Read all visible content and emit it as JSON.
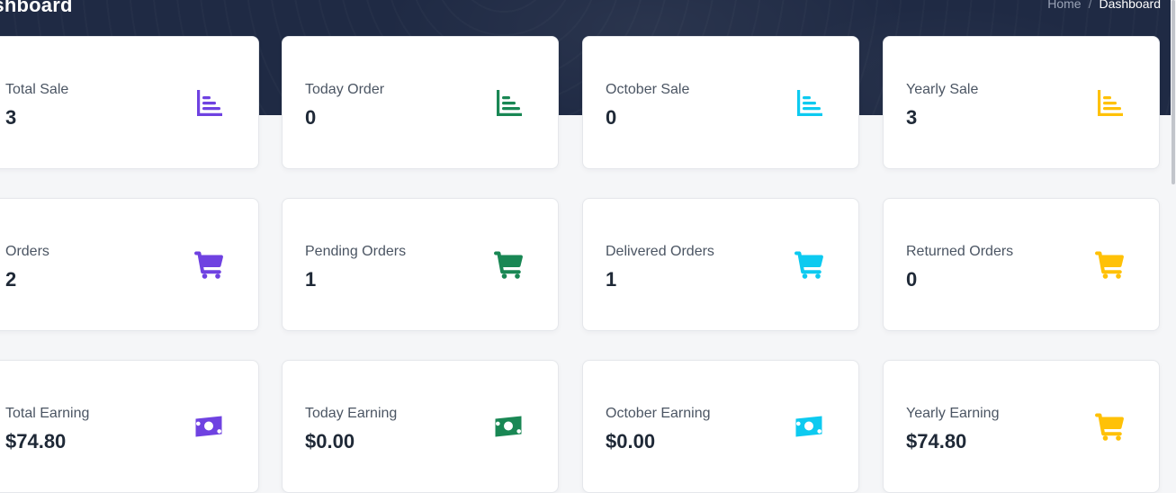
{
  "header": {
    "title": "ashboard",
    "breadcrumb": {
      "home": "Home",
      "separator": "/",
      "current": "Dashboard"
    }
  },
  "colors": {
    "header_bg": "#1f2a44",
    "purple": "#6f42e1",
    "green": "#198754",
    "cyan": "#0dcaf0",
    "yellow": "#ffc107"
  },
  "cards": {
    "total_sale": {
      "label": "Total Sale",
      "value": "3",
      "icon": "bar-chart-icon",
      "color": "#6f42e1"
    },
    "today_order": {
      "label": "Today Order",
      "value": "0",
      "icon": "bar-chart-icon",
      "color": "#198754"
    },
    "october_sale": {
      "label": "October Sale",
      "value": "0",
      "icon": "bar-chart-icon",
      "color": "#0dcaf0"
    },
    "yearly_sale": {
      "label": "Yearly Sale",
      "value": "3",
      "icon": "bar-chart-icon",
      "color": "#ffc107"
    },
    "orders": {
      "label": "Orders",
      "value": "2",
      "icon": "cart-icon",
      "color": "#6f42e1"
    },
    "pending_orders": {
      "label": "Pending Orders",
      "value": "1",
      "icon": "cart-icon",
      "color": "#198754"
    },
    "delivered_orders": {
      "label": "Delivered Orders",
      "value": "1",
      "icon": "cart-icon",
      "color": "#0dcaf0"
    },
    "returned_orders": {
      "label": "Returned Orders",
      "value": "0",
      "icon": "cart-icon",
      "color": "#ffc107"
    },
    "total_earning": {
      "label": "Total Earning",
      "value": "$74.80",
      "icon": "money-bill-icon",
      "color": "#6f42e1"
    },
    "today_earning": {
      "label": "Today Earning",
      "value": "$0.00",
      "icon": "money-bill-icon",
      "color": "#198754"
    },
    "october_earning": {
      "label": "October Earning",
      "value": "$0.00",
      "icon": "money-bill-icon",
      "color": "#0dcaf0"
    },
    "yearly_earning": {
      "label": "Yearly Earning",
      "value": "$74.80",
      "icon": "cart-icon",
      "color": "#ffc107"
    }
  }
}
